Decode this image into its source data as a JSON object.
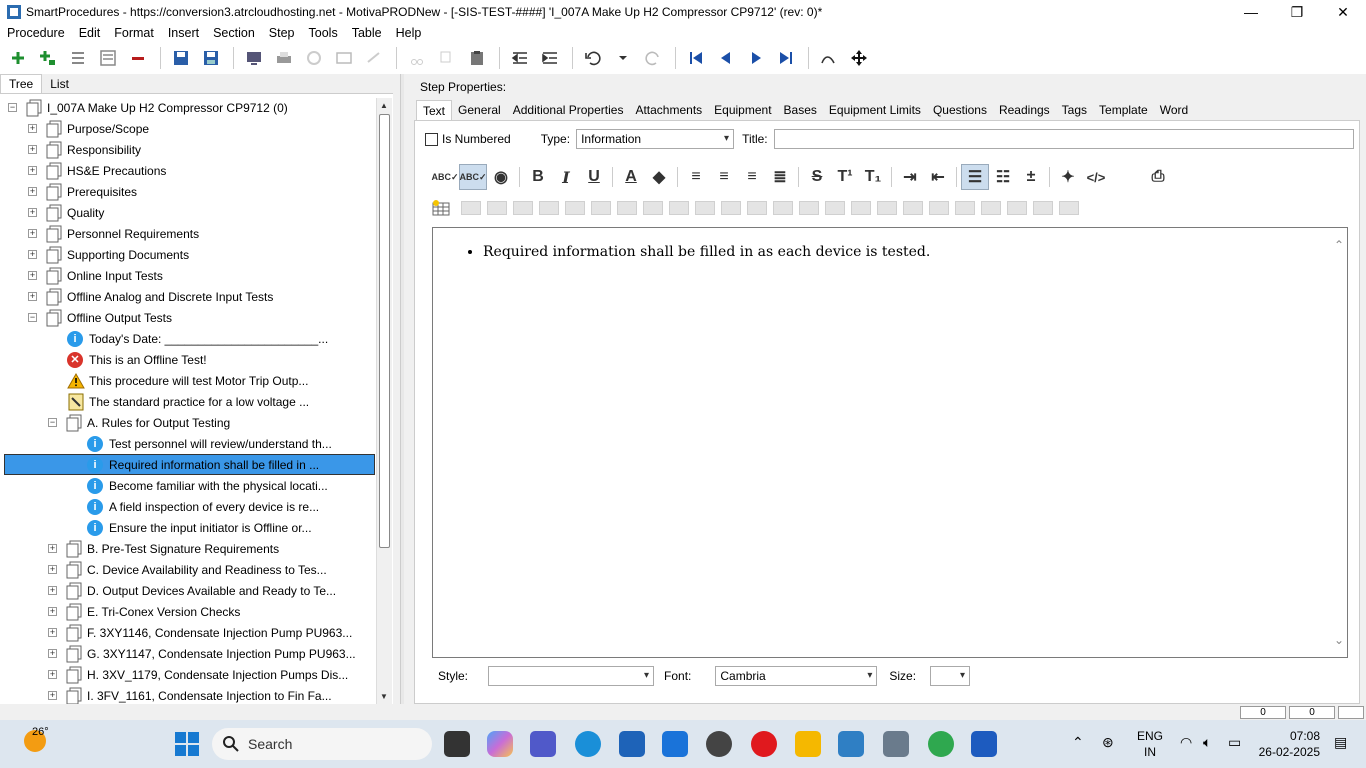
{
  "window": {
    "title": "SmartProcedures - https://conversion3.atrcloudhosting.net - MotivaPRODNew - [-SIS-TEST-####] 'I_007A Make Up H2 Compressor CP9712' (rev: 0)*",
    "minimize": "—",
    "maximize": "❐",
    "close": "✕"
  },
  "menu": [
    "Procedure",
    "Edit",
    "Format",
    "Insert",
    "Section",
    "Step",
    "Tools",
    "Table",
    "Help"
  ],
  "left_tabs": [
    "Tree",
    "List"
  ],
  "tree": {
    "root": "I_007A Make Up H2 Compressor CP9712 (0)",
    "sections": [
      "Purpose/Scope",
      "Responsibility",
      "HS&E Precautions",
      "Prerequisites",
      "Quality",
      "Personnel Requirements",
      "Supporting Documents",
      "Online Input Tests",
      "Offline Analog and Discrete Input Tests",
      "Offline Output Tests"
    ],
    "offline_children": [
      {
        "icon": "info",
        "text": "Today's Date: _______________________..."
      },
      {
        "icon": "error",
        "text": "This is an Offline Test!"
      },
      {
        "icon": "warning",
        "text": "This procedure will test Motor Trip Outp..."
      },
      {
        "icon": "note",
        "text": "The standard practice for a low voltage ..."
      }
    ],
    "subsection_a": "A. Rules for Output Testing",
    "a_children": [
      "Test personnel will review/understand th...",
      "Required information shall be filled in ...",
      "Become familiar with the physical locati...",
      "A field inspection of every device is re...",
      "Ensure the input initiator is Offline or..."
    ],
    "subsections": [
      "B. Pre-Test Signature Requirements",
      "C. Device Availability and Readiness to Tes...",
      "D. Output Devices Available and Ready to Te...",
      "E. Tri-Conex Version Checks",
      "F. 3XY1146, Condensate Injection Pump PU963...",
      "G. 3XY1147, Condensate Injection Pump PU963...",
      "H. 3XV_1179, Condensate Injection Pumps Dis...",
      "I. 3FV_1161, Condensate Injection to Fin Fa..."
    ]
  },
  "step_properties": {
    "label": "Step Properties:",
    "tabs": [
      "Text",
      "General",
      "Additional Properties",
      "Attachments",
      "Equipment",
      "Bases",
      "Equipment Limits",
      "Questions",
      "Readings",
      "Tags",
      "Template",
      "Word"
    ],
    "is_numbered_label": "Is Numbered",
    "type_label": "Type:",
    "type_value": "Information",
    "title_label": "Title:",
    "title_value": "",
    "body_text": "Required information shall be filled in as each device is tested.",
    "style_label": "Style:",
    "style_value": "",
    "font_label": "Font:",
    "font_value": "Cambria",
    "size_label": "Size:",
    "size_value": ""
  },
  "statusbar": {
    "val1": "0",
    "val2": "0"
  },
  "taskbar": {
    "temperature": "26°",
    "search_placeholder": "Search",
    "lang_line1": "ENG",
    "lang_line2": "IN",
    "time": "07:08",
    "date": "26-02-2025"
  }
}
